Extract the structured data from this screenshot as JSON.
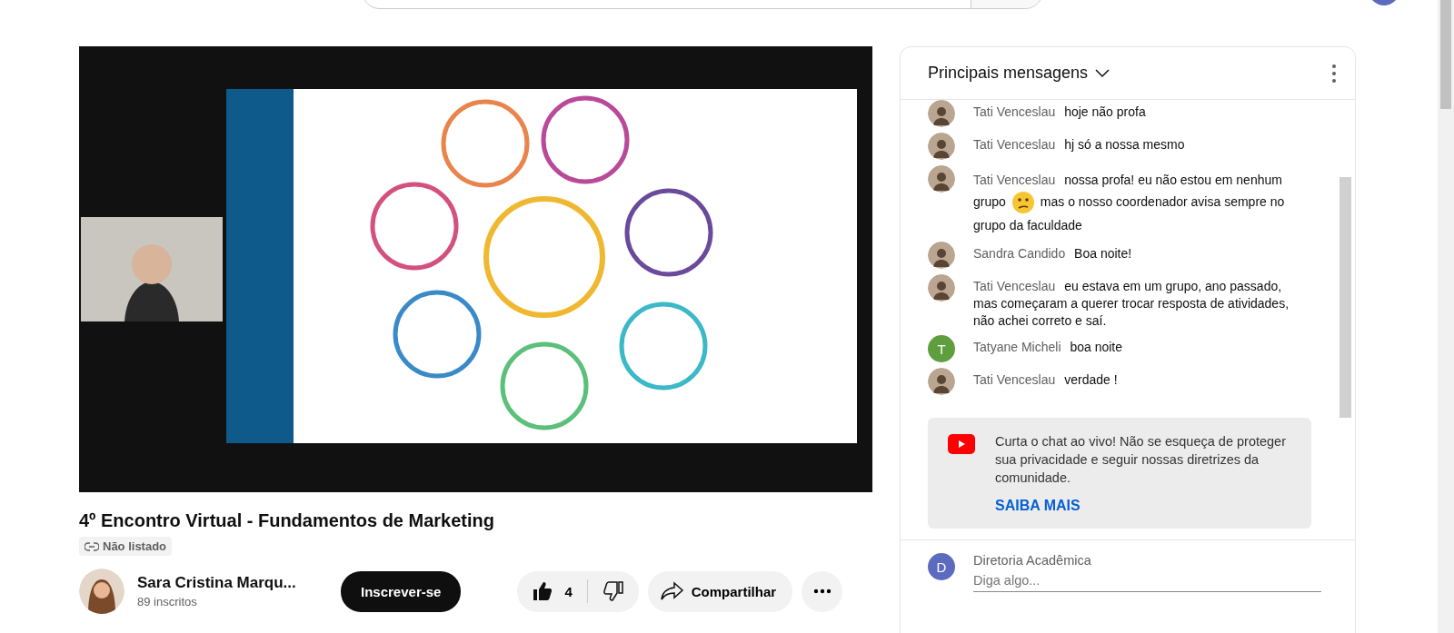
{
  "video": {
    "kind": "picture",
    "title": "4º Encontro Virtual - Fundamentos de Marketing",
    "visibility": "Não listado"
  },
  "channel": {
    "name": "Sara Cristina Marqu...",
    "subscribers": "89 inscritos",
    "subscribe": "Inscrever-se"
  },
  "actions": {
    "likes": "4",
    "share": "Compartilhar"
  },
  "chat": {
    "title": "Principais mensagens",
    "messages": [
      {
        "author": "Tati Venceslau",
        "text": "hoje não profa"
      },
      {
        "author": "Tati Venceslau",
        "text": "hj só a nossa mesmo"
      },
      {
        "author": "Tati Venceslau",
        "text": "nossa profa! eu não estou em nenhum grupo",
        "emoji": true,
        "text_after": "mas o nosso coordenador avisa sempre no grupo da faculdade"
      },
      {
        "author": "Sandra Candido",
        "text": "Boa noite!"
      },
      {
        "author": "Tati Venceslau",
        "text": "eu estava em um grupo, ano passado, mas começaram a querer trocar resposta de atividades, não achei correto e saí."
      },
      {
        "author": "Tatyane Micheli",
        "kind": "letter",
        "initial": "T",
        "color": "#5e9e3e",
        "text": "boa noite"
      },
      {
        "author": "Tati Venceslau",
        "text": "verdade !"
      }
    ],
    "notice": {
      "text": "Curta o chat ao vivo! Não se esqueça de proteger sua privacidade e seguir nossas diretrizes da comunidade.",
      "link": "SAIBA MAIS"
    },
    "composer": {
      "user": "Diretoria Acadêmica",
      "initial": "D",
      "color": "#5c6bc0",
      "placeholder": "Diga algo..."
    }
  }
}
